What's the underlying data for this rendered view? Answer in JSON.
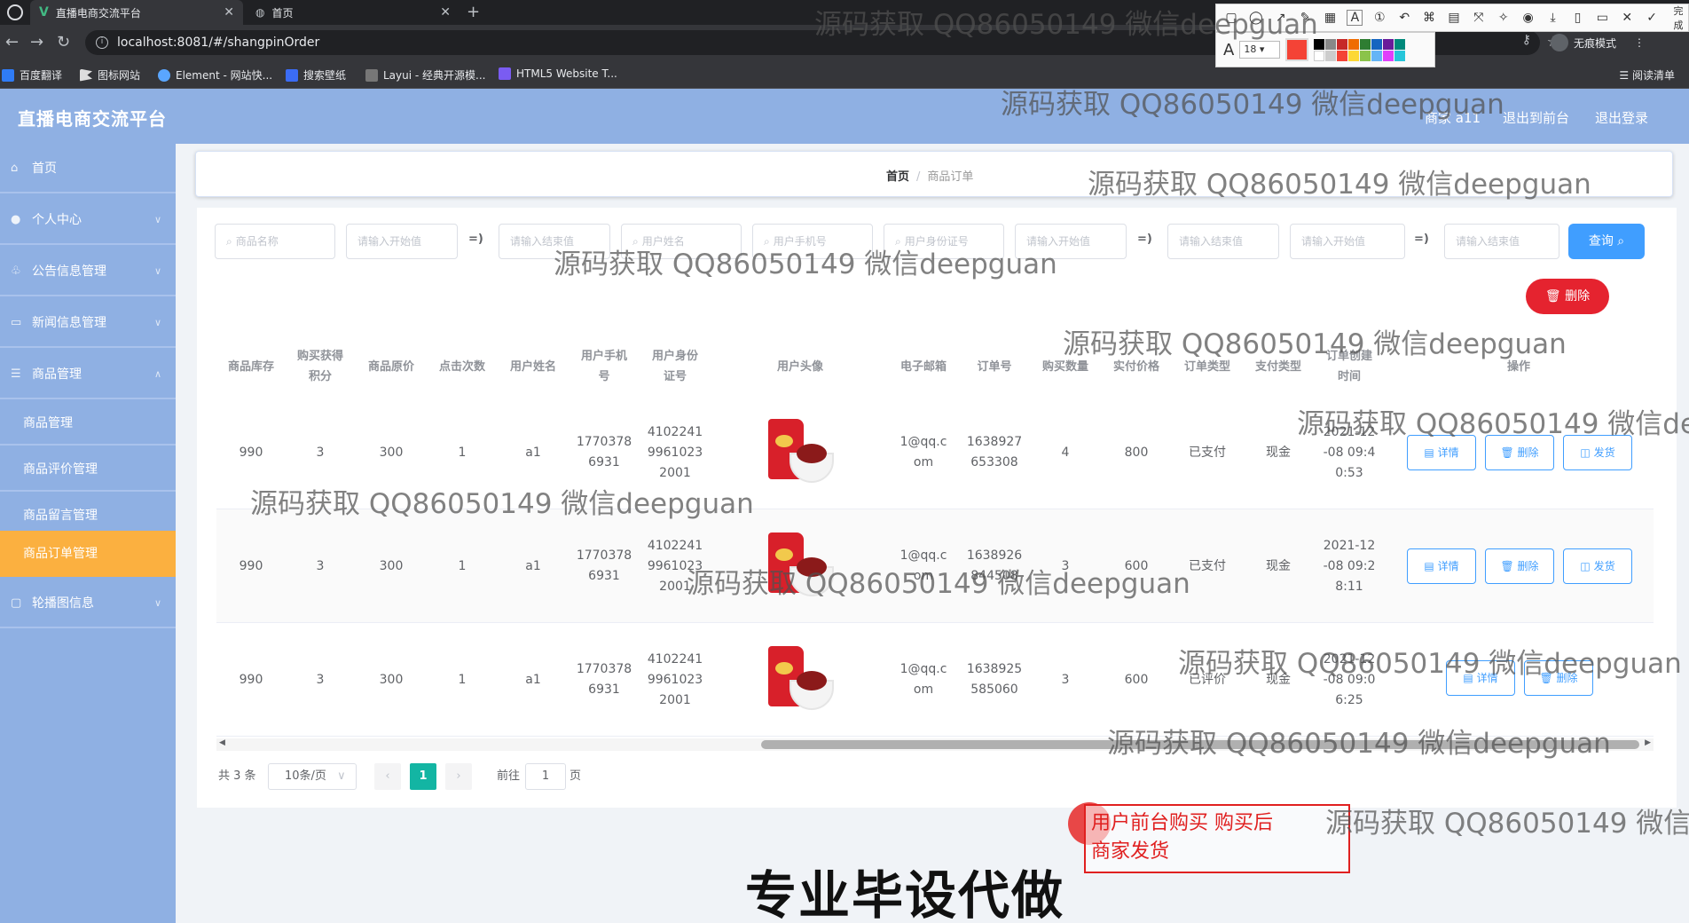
{
  "browser": {
    "tabs": [
      {
        "title": "直播电商交流平台",
        "active": true
      },
      {
        "title": "首页",
        "active": false
      }
    ],
    "url": "localhost:8081/#/shangpinOrder",
    "bookmarks": [
      "百度翻译",
      "图标网站",
      "Element - 网站快...",
      "搜索壁纸",
      "Layui - 经典开源模...",
      "HTML5 Website T..."
    ],
    "reading_list": "阅读清单",
    "incognito": "无痕模式",
    "snap_tool": {
      "font_size": "18",
      "done": "完成"
    }
  },
  "app": {
    "title": "直播电商交流平台",
    "user": "商家 a11",
    "to_admin": "退出到前台",
    "logout": "退出登录"
  },
  "sidebar": {
    "items": [
      {
        "label": "首页"
      },
      {
        "label": "个人中心"
      },
      {
        "label": "公告信息管理"
      },
      {
        "label": "新闻信息管理"
      },
      {
        "label": "商品管理"
      }
    ],
    "sub_items": [
      {
        "label": "商品管理"
      },
      {
        "label": "商品评价管理"
      },
      {
        "label": "商品留言管理"
      },
      {
        "label": "商品订单管理"
      }
    ],
    "last_item": "轮播图信息"
  },
  "breadcrumb": {
    "home": "首页",
    "sep": "/",
    "current": "商品订单"
  },
  "search": {
    "product_name": "商品名称",
    "start1": "请输入开始值",
    "end1": "请输入结束值",
    "user_name": "用户姓名",
    "phone": "用户手机号",
    "idcard": "用户身份证号",
    "start2": "请输入开始值",
    "end2": "请输入结束值",
    "start3": "请输入开始值",
    "end3": "请输入结束值",
    "arrow": "=)",
    "query": "查询",
    "delete": "删除"
  },
  "table": {
    "headers": [
      {
        "line1": "商品库存",
        "line2": ""
      },
      {
        "line1": "购买获得",
        "line2": "积分"
      },
      {
        "line1": "商品原价",
        "line2": ""
      },
      {
        "line1": "点击次数",
        "line2": ""
      },
      {
        "line1": "用户姓名",
        "line2": ""
      },
      {
        "line1": "用户手机",
        "line2": "号"
      },
      {
        "line1": "用户身份",
        "line2": "证号"
      },
      {
        "line1": "用户头像",
        "line2": ""
      },
      {
        "line1": "电子邮箱",
        "line2": ""
      },
      {
        "line1": "订单号",
        "line2": ""
      },
      {
        "line1": "购买数量",
        "line2": ""
      },
      {
        "line1": "实付价格",
        "line2": ""
      },
      {
        "line1": "订单类型",
        "line2": ""
      },
      {
        "line1": "支付类型",
        "line2": ""
      },
      {
        "line1": "订单创建",
        "line2": "时间"
      },
      {
        "line1": "操作",
        "line2": ""
      }
    ],
    "rows": [
      {
        "stock": "990",
        "points": "3",
        "price": "300",
        "clicks": "1",
        "name": "a1",
        "phone": [
          "1770378",
          "6931"
        ],
        "idcard": [
          "4102241",
          "9961023",
          "2001"
        ],
        "email": [
          "1@qq.c",
          "om"
        ],
        "order_no": [
          "1638927",
          "653308"
        ],
        "qty": "4",
        "paid": "800",
        "status": "已支付",
        "pay_type": "现金",
        "time": [
          "2021-12",
          "-08 09:4",
          "0:53"
        ],
        "actions": [
          "详情",
          "删除",
          "发货"
        ]
      },
      {
        "stock": "990",
        "points": "3",
        "price": "300",
        "clicks": "1",
        "name": "a1",
        "phone": [
          "1770378",
          "6931"
        ],
        "idcard": [
          "4102241",
          "9961023",
          "2001"
        ],
        "email": [
          "1@qq.c",
          "om"
        ],
        "order_no": [
          "1638926",
          "844508"
        ],
        "qty": "3",
        "paid": "600",
        "status": "已支付",
        "pay_type": "现金",
        "time": [
          "2021-12",
          "-08 09:2",
          "8:11"
        ],
        "actions": [
          "详情",
          "删除",
          "发货"
        ]
      },
      {
        "stock": "990",
        "points": "3",
        "price": "300",
        "clicks": "1",
        "name": "a1",
        "phone": [
          "1770378",
          "6931"
        ],
        "idcard": [
          "4102241",
          "9961023",
          "2001"
        ],
        "email": [
          "1@qq.c",
          "om"
        ],
        "order_no": [
          "1638925",
          "585060"
        ],
        "qty": "3",
        "paid": "600",
        "status": "已评价",
        "pay_type": "现金",
        "time": [
          "2021-12",
          "-08 09:0",
          "6:25"
        ],
        "actions": [
          "详情",
          "删除"
        ]
      }
    ]
  },
  "pagination": {
    "total": "共 3 条",
    "page_size": "10条/页",
    "current": "1",
    "goto": "前往",
    "goto_value": "1",
    "page_unit": "页"
  },
  "annotation": {
    "line1": "用户前台购买  购买后",
    "line2": "商家发货"
  },
  "caption": "专业毕设代做",
  "watermark": "源码获取 QQ86050149 微信deepguan"
}
